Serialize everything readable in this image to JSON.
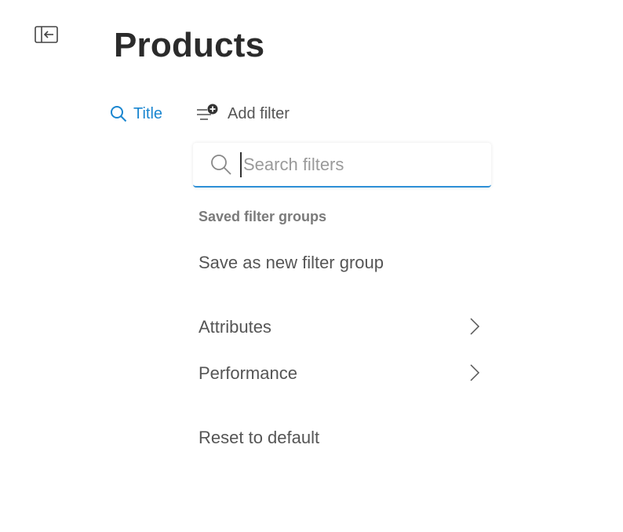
{
  "sidebar_toggle": {
    "icon": "collapse-sidebar-icon"
  },
  "header": {
    "title": "Products"
  },
  "filters": {
    "title_chip": {
      "label": "Title",
      "icon": "search-icon"
    },
    "add_filter": {
      "label": "Add filter",
      "icon": "add-filter-icon"
    }
  },
  "dropdown": {
    "search": {
      "placeholder": "Search filters",
      "value": ""
    },
    "section_header": "Saved filter groups",
    "save_new": "Save as new filter group",
    "categories": [
      {
        "label": "Attributes",
        "icon": "chevron-right-icon"
      },
      {
        "label": "Performance",
        "icon": "chevron-right-icon"
      }
    ],
    "reset": "Reset to default"
  },
  "colors": {
    "accent": "#1a86d0",
    "text": "#555555",
    "title": "#2b2b2b",
    "muted": "#7a7a7a"
  }
}
